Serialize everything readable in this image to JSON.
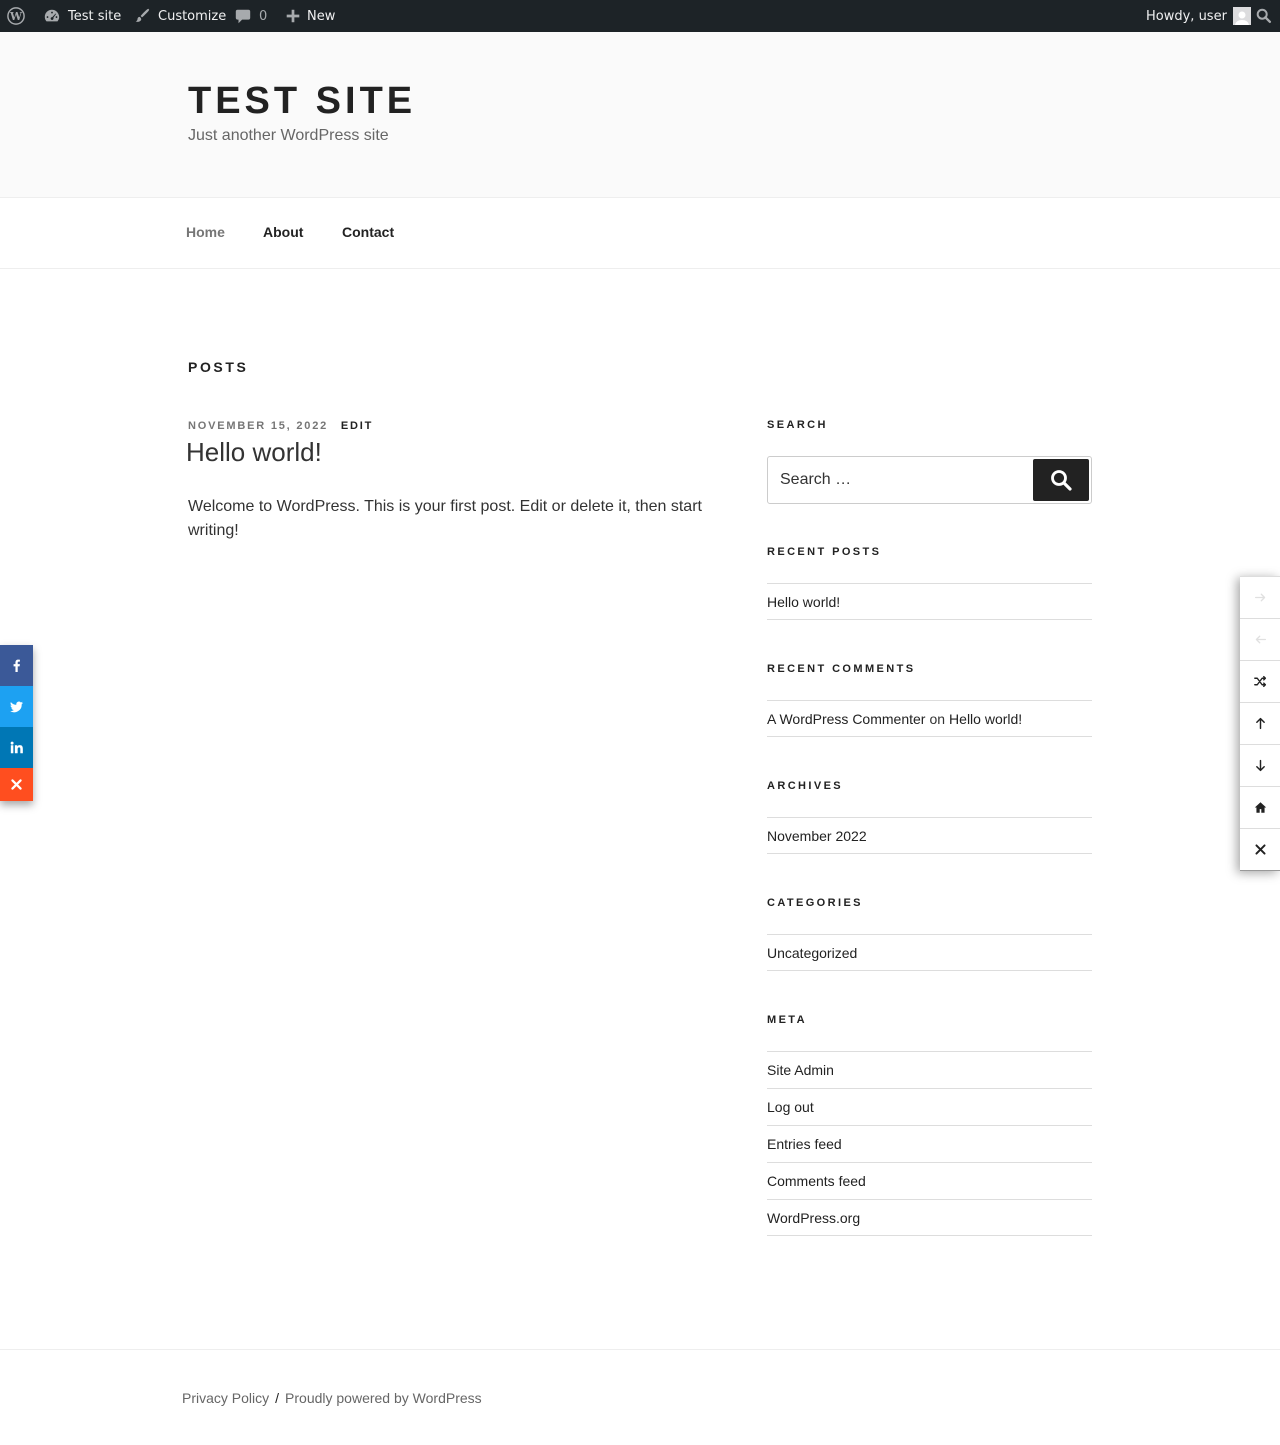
{
  "adminbar": {
    "site_name": "Test site",
    "customize": "Customize",
    "comments_count": "0",
    "new": "New",
    "howdy": "Howdy, user"
  },
  "header": {
    "title": "TEST SITE",
    "description": "Just another WordPress site"
  },
  "nav": {
    "items": [
      {
        "label": "Home"
      },
      {
        "label": "About"
      },
      {
        "label": "Contact"
      }
    ]
  },
  "main": {
    "heading": "POSTS",
    "post": {
      "date": "NOVEMBER 15, 2022",
      "edit": "EDIT",
      "title": "Hello world!",
      "excerpt": "Welcome to WordPress. This is your first post. Edit or delete it, then start writing!"
    }
  },
  "sidebar": {
    "search": {
      "title": "SEARCH",
      "placeholder": "Search …"
    },
    "recent_posts": {
      "title": "RECENT POSTS",
      "items": [
        "Hello world!"
      ]
    },
    "recent_comments": {
      "title": "RECENT COMMENTS",
      "author": "A WordPress Commenter",
      "on": "on",
      "post": "Hello world!"
    },
    "archives": {
      "title": "ARCHIVES",
      "items": [
        "November 2022"
      ]
    },
    "categories": {
      "title": "CATEGORIES",
      "items": [
        "Uncategorized"
      ]
    },
    "meta": {
      "title": "META",
      "items": [
        "Site Admin",
        "Log out",
        "Entries feed",
        "Comments feed",
        "WordPress.org"
      ]
    }
  },
  "footer": {
    "privacy": "Privacy Policy",
    "separator": "/",
    "powered": "Proudly powered by WordPress"
  },
  "social": {
    "colors": {
      "facebook": "#3b5998",
      "twitter": "#1da1f2",
      "linkedin": "#0077b5",
      "close": "#ff4e1f"
    }
  }
}
